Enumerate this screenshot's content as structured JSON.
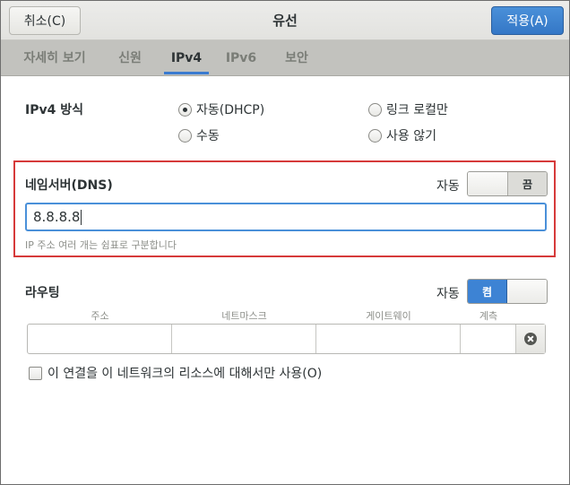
{
  "header": {
    "title": "유선",
    "cancel_label": "취소(C)",
    "apply_label": "적용(A)"
  },
  "tabs": [
    {
      "label": "자세히 보기",
      "active": false
    },
    {
      "label": "신원",
      "active": false
    },
    {
      "label": "IPv4",
      "active": true
    },
    {
      "label": "IPv6",
      "active": false
    },
    {
      "label": "보안",
      "active": false
    }
  ],
  "ipv4_method": {
    "label": "IPv4 방식",
    "options": [
      {
        "label": "자동(DHCP)",
        "checked": true
      },
      {
        "label": "링크 로컬만",
        "checked": false
      },
      {
        "label": "수동",
        "checked": false
      },
      {
        "label": "사용 않기",
        "checked": false
      }
    ]
  },
  "dns": {
    "label": "네임서버(DNS)",
    "auto_label": "자동",
    "switch_text": "끔",
    "switch_state": "off",
    "value": "8.8.8.8",
    "hint": "IP 주소 여러 개는 쉼표로 구분합니다"
  },
  "routing": {
    "label": "라우팅",
    "auto_label": "자동",
    "switch_text": "켬",
    "switch_state": "on",
    "columns": [
      "주소",
      "네트마스크",
      "게이트웨이",
      "계측"
    ],
    "rows": [
      {
        "address": "",
        "netmask": "",
        "gateway": "",
        "metric": ""
      }
    ]
  },
  "only_local_resources": {
    "label": "이 연결을 이 네트워크의 리소스에 대해서만 사용(O)",
    "checked": false
  },
  "colors": {
    "accent": "#4a90d9",
    "highlight_frame": "#d63a3a",
    "tabbar_bg": "#c2c2be"
  },
  "icons": {
    "route_delete": "clear-circle-icon",
    "caret": "text-caret"
  }
}
